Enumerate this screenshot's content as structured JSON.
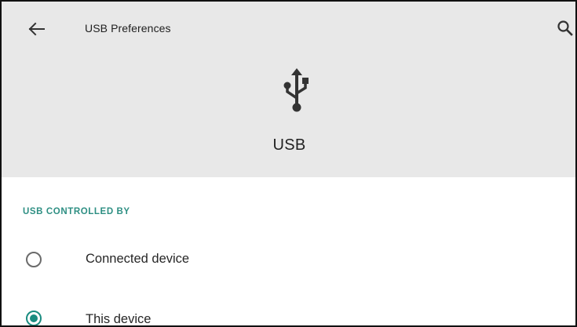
{
  "toolbar": {
    "title": "USB Preferences",
    "back_icon": "arrow-back-icon",
    "search_icon": "search-icon"
  },
  "hero": {
    "icon": "usb-icon",
    "label": "USB"
  },
  "section": {
    "title": "USB CONTROLLED BY"
  },
  "options": [
    {
      "label": "Connected device",
      "selected": false
    },
    {
      "label": "This device",
      "selected": true
    }
  ],
  "colors": {
    "accent": "#1a8c80",
    "section_title": "#2e8f83",
    "header_bg": "#e8e8e8",
    "text": "#262626"
  }
}
